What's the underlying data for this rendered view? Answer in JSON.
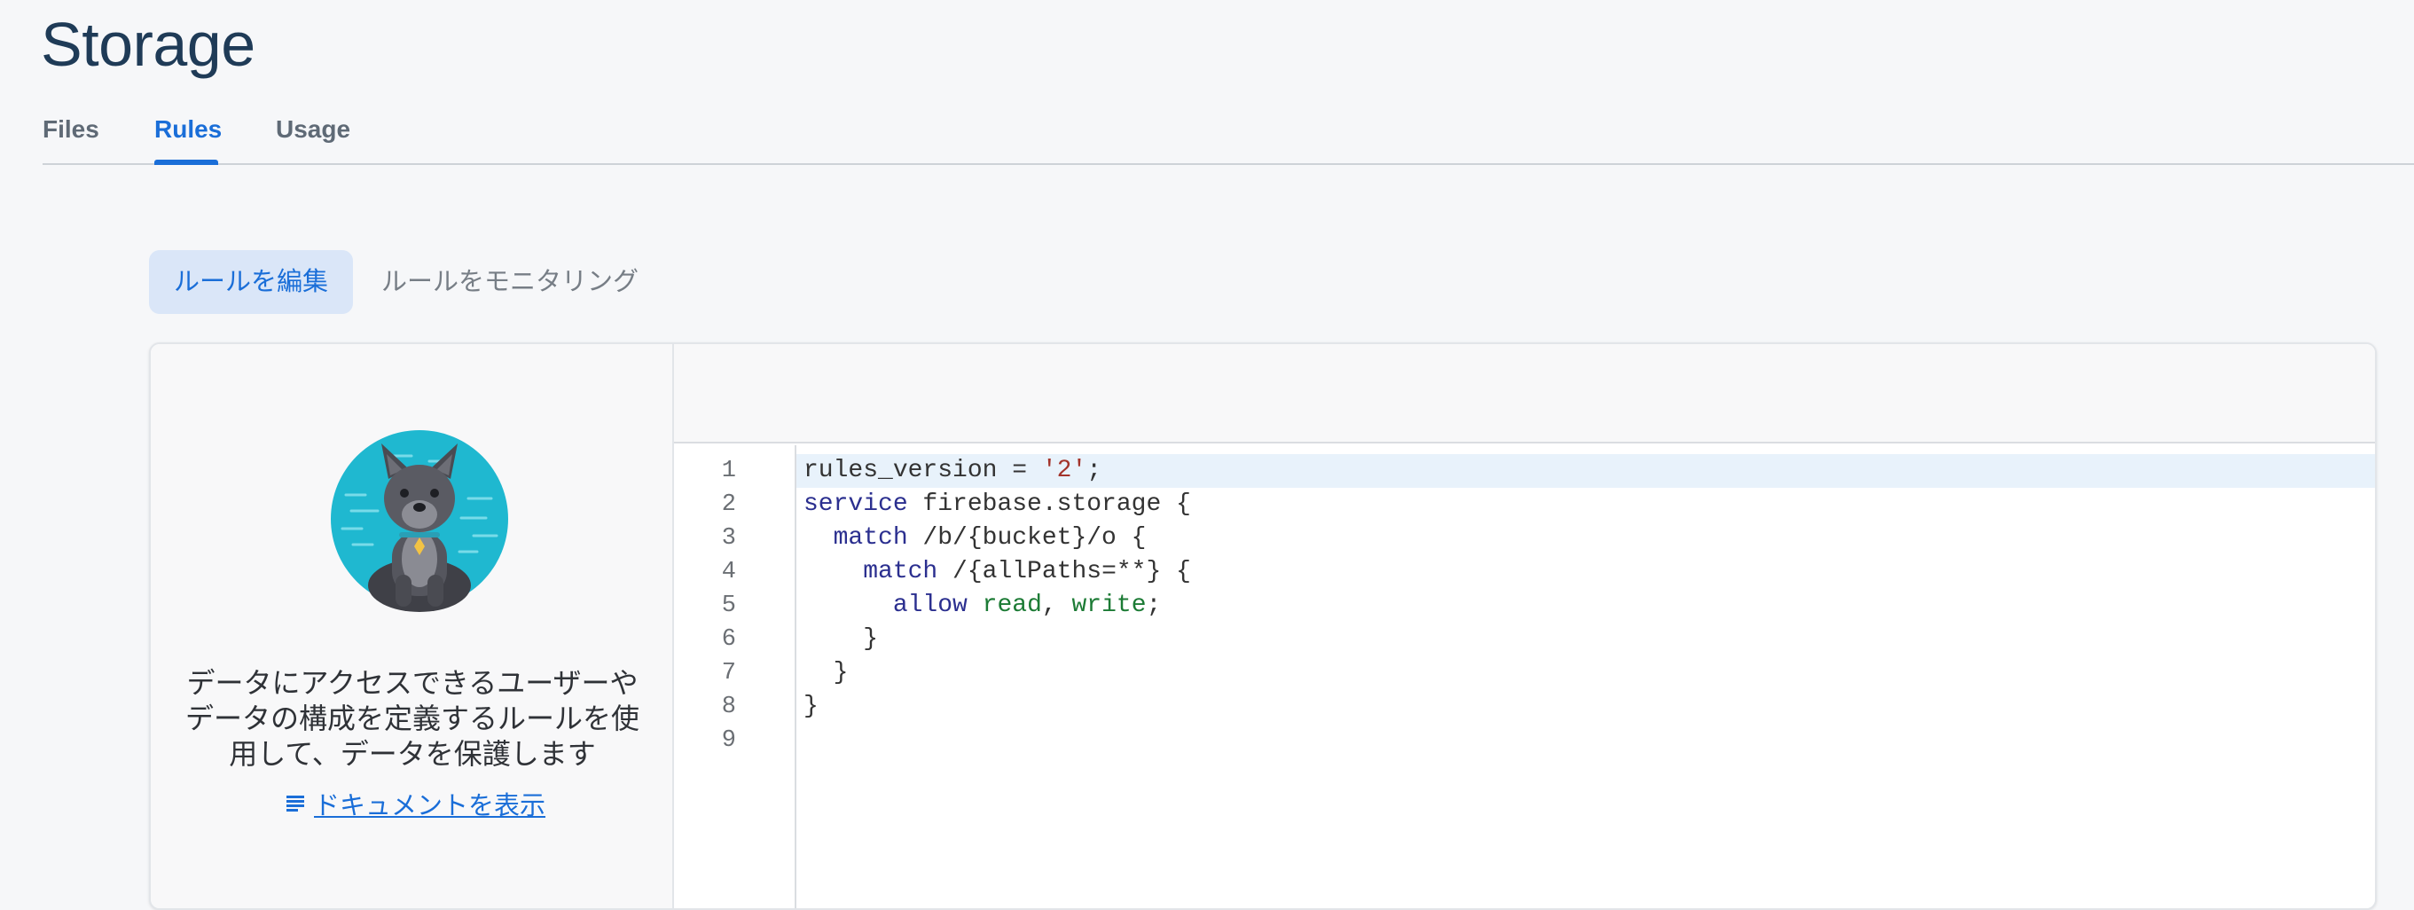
{
  "page": {
    "title": "Storage"
  },
  "tabs": [
    {
      "label": "Files",
      "active": false
    },
    {
      "label": "Rules",
      "active": true
    },
    {
      "label": "Usage",
      "active": false
    }
  ],
  "subtabs": [
    {
      "label": "ルールを編集",
      "active": true
    },
    {
      "label": "ルールをモニタリング",
      "active": false
    }
  ],
  "info_panel": {
    "mascot_icon": "firebase-dog-mascot",
    "description": "データにアクセスできるユーザーやデータの構成を定義するルールを使用して、データを保護します",
    "description_lines": [
      "データにアクセスできるユーザーや",
      "データの構成を定義するルールを使",
      "用して、データを保護します"
    ],
    "doc_link_icon": "document-lines-icon",
    "doc_link_label": "ドキュメントを表示"
  },
  "editor": {
    "line_numbers": [
      "1",
      "2",
      "3",
      "4",
      "5",
      "6",
      "7",
      "8",
      "9"
    ],
    "lines": [
      [
        {
          "t": "rules_version = ",
          "k": "plain"
        },
        {
          "t": "'2'",
          "k": "string"
        },
        {
          "t": ";",
          "k": "plain"
        }
      ],
      [
        {
          "t": "service",
          "k": "keyword"
        },
        {
          "t": " firebase.storage {",
          "k": "plain"
        }
      ],
      [
        {
          "t": "  ",
          "k": "plain"
        },
        {
          "t": "match",
          "k": "keyword"
        },
        {
          "t": " /b/{bucket}/o {",
          "k": "plain"
        }
      ],
      [
        {
          "t": "    ",
          "k": "plain"
        },
        {
          "t": "match",
          "k": "keyword"
        },
        {
          "t": " /{allPaths=**} {",
          "k": "plain"
        }
      ],
      [
        {
          "t": "      ",
          "k": "plain"
        },
        {
          "t": "allow",
          "k": "keyword"
        },
        {
          "t": " ",
          "k": "plain"
        },
        {
          "t": "read",
          "k": "perm"
        },
        {
          "t": ", ",
          "k": "plain"
        },
        {
          "t": "write",
          "k": "perm"
        },
        {
          "t": ";",
          "k": "plain"
        }
      ],
      [
        {
          "t": "    }",
          "k": "plain"
        }
      ],
      [
        {
          "t": "  }",
          "k": "plain"
        }
      ],
      [
        {
          "t": "}",
          "k": "plain"
        }
      ],
      [
        {
          "t": "",
          "k": "plain"
        }
      ]
    ],
    "highlighted_line": 1
  },
  "colors": {
    "accent": "#1a6ed8",
    "title": "#1f3b57",
    "keyword": "#2b2f8f",
    "string": "#a3342b",
    "permission": "#1c7b35",
    "active_line": "#e8f2fb",
    "mascot_circle": "#1fb8d0"
  }
}
